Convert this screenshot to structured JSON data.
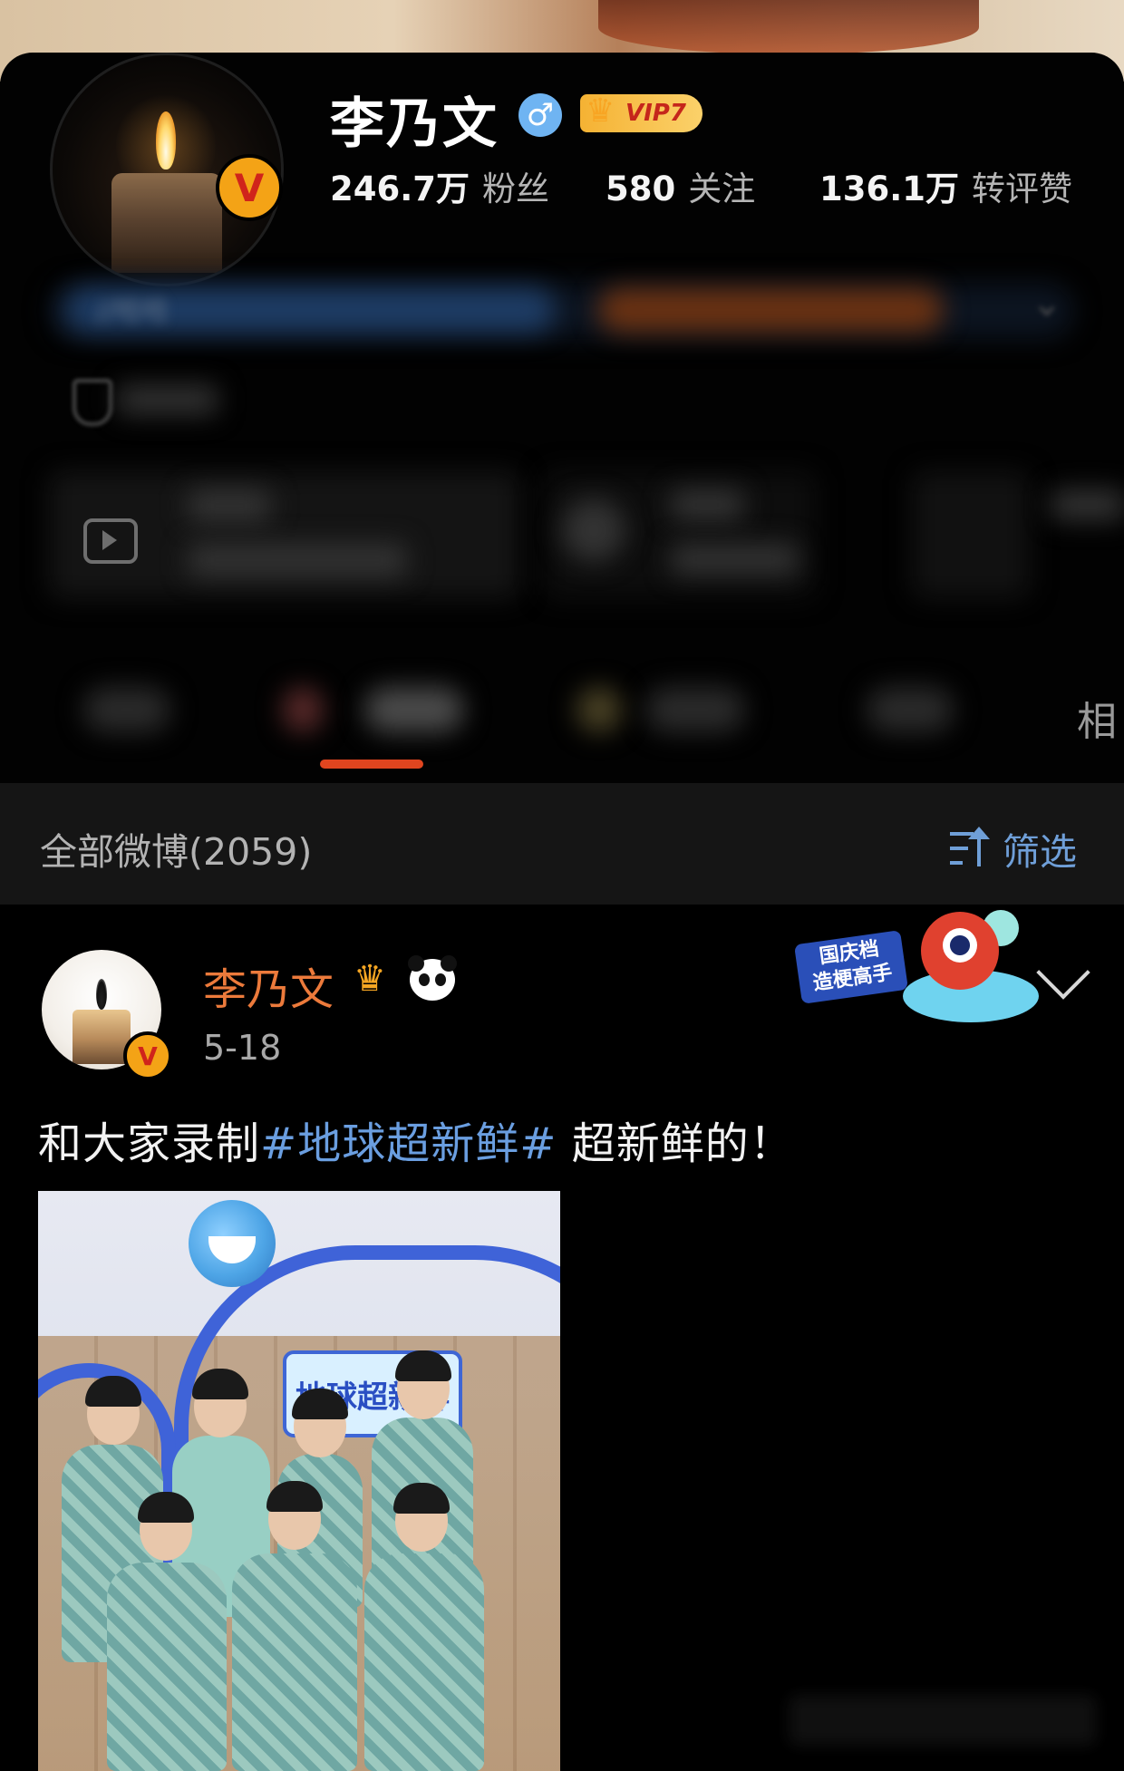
{
  "profile": {
    "name": "李乃文",
    "gender_icon": "male-icon",
    "vip_label": "VIP7",
    "verified_badge": "V",
    "stats": [
      {
        "value": "246.7万",
        "label": "粉丝"
      },
      {
        "value": "580",
        "label": "关注"
      },
      {
        "value": "136.1万",
        "label": "转评赞"
      }
    ],
    "bio_partial": "//哈哈",
    "tab_partial": "相"
  },
  "posts_header": {
    "title": "全部微博(2059)",
    "filter_label": "筛选"
  },
  "post": {
    "author": "李乃文",
    "date": "5-18",
    "text_before": "和大家录制",
    "hashtag": "#地球超新鲜#",
    "text_after": " 超新鲜的！",
    "sticker_line1": "国庆档",
    "sticker_line2": "造梗高手",
    "photo_sign": "地球超新鲜"
  },
  "colors": {
    "accent_orange": "#ec7a3b",
    "link_blue": "#6a9ee0",
    "tab_indicator": "#e0451f",
    "vip_gold": "#f5b233"
  }
}
